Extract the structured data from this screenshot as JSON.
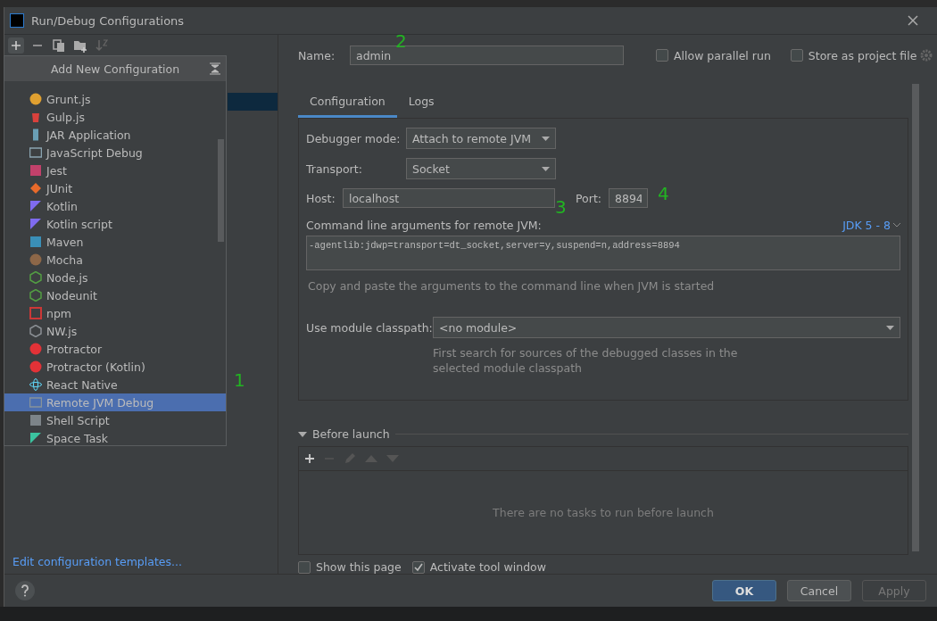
{
  "window": {
    "title": "Run/Debug Configurations"
  },
  "popup": {
    "title": "Add New Configuration",
    "items": [
      {
        "label": "Grunt.js",
        "kind": "grunt",
        "selected": false
      },
      {
        "label": "Gulp.js",
        "kind": "gulp",
        "selected": false
      },
      {
        "label": "JAR Application",
        "kind": "jar",
        "selected": false
      },
      {
        "label": "JavaScript Debug",
        "kind": "jsdebug",
        "selected": false
      },
      {
        "label": "Jest",
        "kind": "jest",
        "selected": false
      },
      {
        "label": "JUnit",
        "kind": "junit",
        "selected": false
      },
      {
        "label": "Kotlin",
        "kind": "kotlin",
        "selected": false
      },
      {
        "label": "Kotlin script",
        "kind": "kotlin",
        "selected": false
      },
      {
        "label": "Maven",
        "kind": "maven",
        "selected": false
      },
      {
        "label": "Mocha",
        "kind": "mocha",
        "selected": false
      },
      {
        "label": "Node.js",
        "kind": "node",
        "selected": false
      },
      {
        "label": "Nodeunit",
        "kind": "node",
        "selected": false
      },
      {
        "label": "npm",
        "kind": "npm",
        "selected": false
      },
      {
        "label": "NW.js",
        "kind": "nw",
        "selected": false
      },
      {
        "label": "Protractor",
        "kind": "protractor",
        "selected": false
      },
      {
        "label": "Protractor (Kotlin)",
        "kind": "protractor",
        "selected": false
      },
      {
        "label": "React Native",
        "kind": "react",
        "selected": false
      },
      {
        "label": "Remote JVM Debug",
        "kind": "remote",
        "selected": true
      },
      {
        "label": "Shell Script",
        "kind": "shell",
        "selected": false
      },
      {
        "label": "Space Task",
        "kind": "space",
        "selected": false
      }
    ]
  },
  "left_panel": {
    "link": "Edit configuration templates..."
  },
  "form": {
    "name": {
      "label": "Name:",
      "value": "admin"
    },
    "allow_parallel": {
      "label": "Allow parallel run",
      "checked": false
    },
    "store_as_project": {
      "label": "Store as project file",
      "checked": false
    },
    "tabs": [
      {
        "label": "Configuration",
        "selected": true
      },
      {
        "label": "Logs",
        "selected": false
      }
    ],
    "debugger_mode": {
      "label": "Debugger mode:",
      "value": "Attach to remote JVM"
    },
    "transport": {
      "label": "Transport:",
      "value": "Socket"
    },
    "host": {
      "label": "Host:",
      "value": "localhost"
    },
    "port": {
      "label": "Port:",
      "value": "8894"
    },
    "arguments": {
      "label": "Command line arguments for remote JVM:",
      "jdk": "JDK 5 - 8",
      "value": "-agentlib:jdwp=transport=dt_socket,server=y,suspend=n,address=8894",
      "hint": "Copy and paste the arguments to the command line when JVM is started"
    },
    "module": {
      "label": "Use module classpath:",
      "value": "<no module>",
      "hint": "First search for sources of the debugged classes in the selected module classpath"
    }
  },
  "before_launch": {
    "title": "Before launch",
    "expanded": true,
    "empty_text": "There are no tasks to run before launch"
  },
  "options": [
    {
      "label": "Show this page",
      "checked": false
    },
    {
      "label": "Activate tool window",
      "checked": true
    }
  ],
  "buttons": [
    {
      "label": "OK",
      "kind": "primary"
    },
    {
      "label": "Cancel",
      "kind": "normal"
    },
    {
      "label": "Apply",
      "kind": "disabled"
    }
  ],
  "annotations": [
    "1",
    "2",
    "3",
    "4"
  ]
}
